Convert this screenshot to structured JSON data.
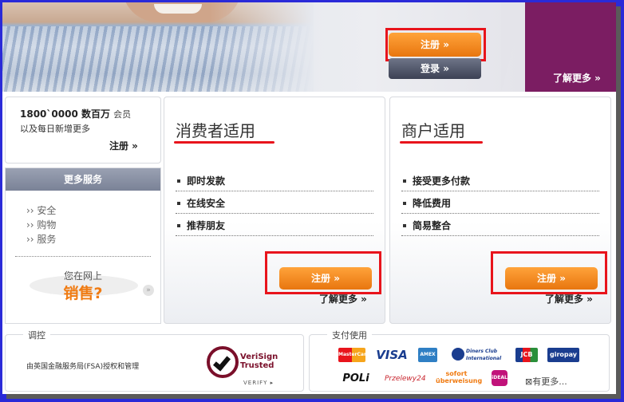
{
  "banner": {
    "register_label": "注册 »",
    "login_label": "登录 »",
    "learn_more": "了解更多 »",
    "colors": {
      "accent_orange": "#f08a1c",
      "purple": "#7b1d62",
      "highlight_red": "#e8141c"
    }
  },
  "member": {
    "count_prefix": "1800`0000 数百万",
    "count_suffix": "会员",
    "subline": "以及每日新增更多",
    "register_link": "注册 »"
  },
  "services": {
    "heading": "更多服务",
    "items": [
      "安全",
      "购物",
      "服务"
    ],
    "sell_prefix": "您在网上",
    "sell_big": "销售?"
  },
  "consumer": {
    "title": "消费者适用",
    "items": [
      "即时发款",
      "在线安全",
      "推荐朋友"
    ],
    "register": "注册 »",
    "more": "了解更多 »"
  },
  "merchant": {
    "title": "商户适用",
    "items": [
      "接受更多付款",
      "降低费用",
      "简易整合"
    ],
    "register": "注册 »",
    "more": "了解更多 »"
  },
  "regulated": {
    "legend": "调控",
    "text": "由英国金融服务局(FSA)授权和管理",
    "badge_title": "VeriSign Trusted",
    "badge_verify": "VERIFY ▸"
  },
  "payments": {
    "legend": "支付使用",
    "logos": [
      "MasterCard",
      "VISA",
      "AMEX",
      "Diners Club International",
      "JCB",
      "giropay",
      "POLi",
      "Przelewy24",
      "sofort überweisung",
      "iDEAL"
    ],
    "more": "有更多..."
  }
}
